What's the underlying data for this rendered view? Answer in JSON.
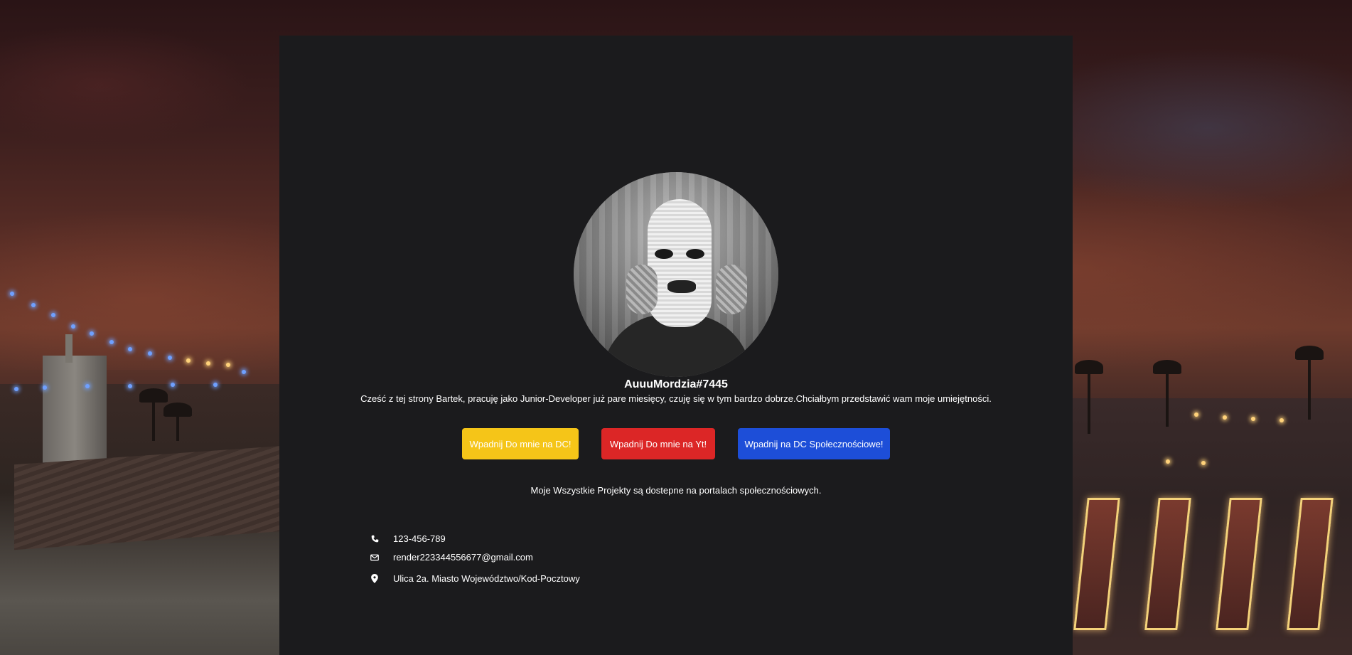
{
  "profile": {
    "username": "AuuuMordzia#7445",
    "intro": "Cześć z tej strony Bartek, pracuję jako Junior-Developer już pare miesięcy, czuję się w tym bardzo dobrze.Chciałbym przedstawić wam moje umiejętności.",
    "avatar_alt": ""
  },
  "buttons": {
    "dc_label": "Wpadnij Do mnie na DC!",
    "yt_label": "Wpadnij Do mnie na Yt!",
    "community_label": "Wpadnij na DC Społecznościowe!"
  },
  "colors": {
    "panel": "#1b1b1d",
    "yellow_button": "#f5c518",
    "red_button": "#dc2626",
    "blue_button": "#1d4ed8"
  },
  "projects_text": "Moje Wszystkie Projekty są dostepne na portalach społecznościowych.",
  "contact": {
    "phone": "123-456-789",
    "email": "render223344556677@gmail.com",
    "address": "Ulica 2a. Miasto Województwo/Kod-Pocztowy",
    "phone_icon": "phone-icon",
    "email_icon": "envelope-icon",
    "address_icon": "map-pin-icon"
  }
}
